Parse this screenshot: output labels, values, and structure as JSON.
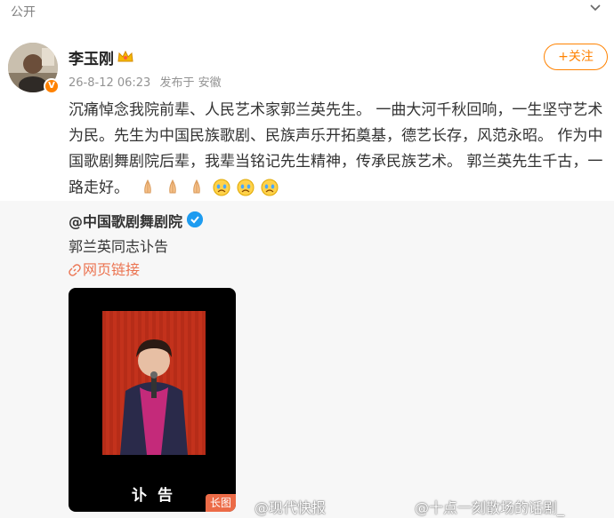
{
  "header": {
    "visibility": "公开",
    "chevron_icon": "chevron-down-icon"
  },
  "post": {
    "author": {
      "name": "李玉刚",
      "verified_badge": "V",
      "member_icon": "crown-icon"
    },
    "meta": {
      "time": "26-8-12 06:23",
      "published_in": "发布于 安徽"
    },
    "follow_label": "+关注",
    "text": "沉痛悼念我院前辈、人民艺术家郭兰英先生。 一曲大河千秋回响，一生坚守艺术为民。先生为中国民族歌剧、民族声乐开拓奠基，德艺长存，风范永昭。 作为中国歌剧舞剧院后辈，我辈当铭记先生精神，传承民族艺术。 郭兰英先生千古，一路走好。",
    "emojis": [
      "pray-emoji",
      "pray-emoji",
      "pray-emoji",
      "crying-emoji",
      "crying-emoji",
      "crying-emoji"
    ]
  },
  "repost": {
    "user": "@中国歌剧舞剧院",
    "title": "郭兰英同志讣告",
    "link_label": "网页链接",
    "image": {
      "caption": "讣告",
      "badge": "长图"
    }
  },
  "watermarks": [
    "@现代快报",
    "@十点一刻散场的话剧_"
  ],
  "colors": {
    "accent": "#ff8200",
    "link": "#eb7350",
    "verified_blue": "#1e9cf0",
    "repost_bg": "#f7f7f7",
    "meta_gray": "#939393"
  }
}
